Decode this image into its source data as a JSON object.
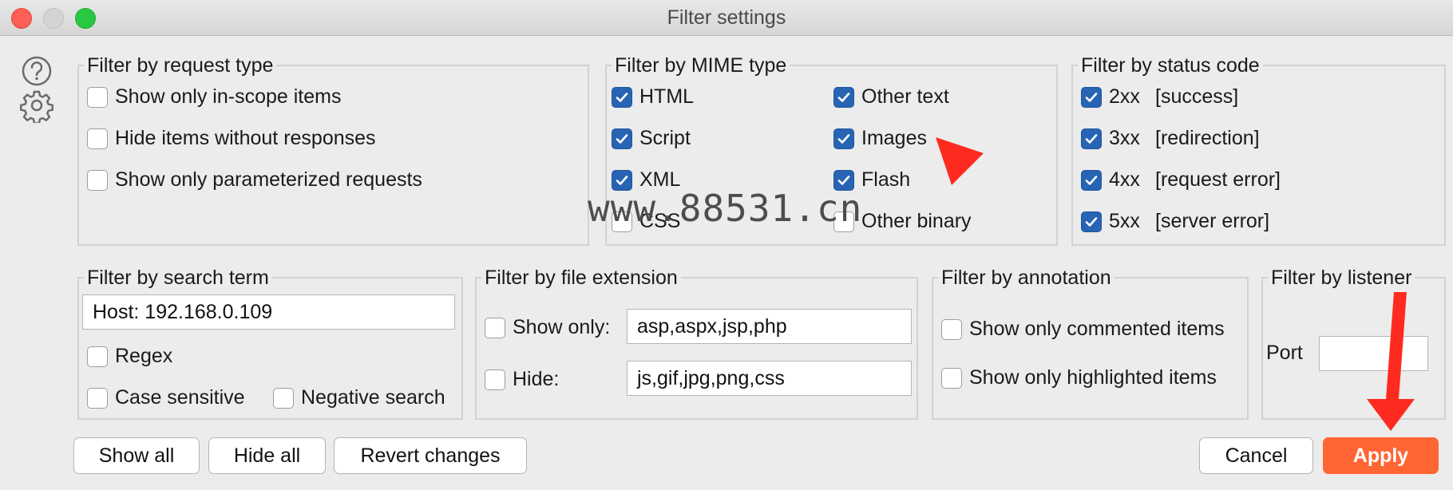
{
  "window": {
    "title": "Filter settings"
  },
  "sidebar": {
    "help_icon": "question-circle-icon",
    "settings_icon": "gear-icon"
  },
  "request_type": {
    "title": "Filter by request type",
    "items": [
      {
        "label": "Show only in-scope items",
        "checked": false
      },
      {
        "label": "Hide items without responses",
        "checked": false
      },
      {
        "label": "Show only parameterized requests",
        "checked": false
      }
    ]
  },
  "mime_type": {
    "title": "Filter by MIME type",
    "items": [
      {
        "label": "HTML",
        "checked": true
      },
      {
        "label": "Other text",
        "checked": true
      },
      {
        "label": "Script",
        "checked": true
      },
      {
        "label": "Images",
        "checked": true
      },
      {
        "label": "XML",
        "checked": true
      },
      {
        "label": "Flash",
        "checked": true
      },
      {
        "label": "CSS",
        "checked": false
      },
      {
        "label": "Other binary",
        "checked": false
      }
    ]
  },
  "status_code": {
    "title": "Filter by status code",
    "items": [
      {
        "code": "2xx",
        "desc": "[success]",
        "checked": true
      },
      {
        "code": "3xx",
        "desc": "[redirection]",
        "checked": true
      },
      {
        "code": "4xx",
        "desc": "[request error]",
        "checked": true
      },
      {
        "code": "5xx",
        "desc": "[server error]",
        "checked": true
      }
    ]
  },
  "search_term": {
    "title": "Filter by search term",
    "value": "Host: 192.168.0.109",
    "regex_label": "Regex",
    "regex_checked": false,
    "case_label": "Case sensitive",
    "case_checked": false,
    "negative_label": "Negative search",
    "negative_checked": false
  },
  "file_extension": {
    "title": "Filter by file extension",
    "show_only_label": "Show only:",
    "show_only_checked": false,
    "show_only_value": "asp,aspx,jsp,php",
    "hide_label": "Hide:",
    "hide_checked": false,
    "hide_value": "js,gif,jpg,png,css"
  },
  "annotation": {
    "title": "Filter by annotation",
    "commented_label": "Show only commented items",
    "commented_checked": false,
    "highlighted_label": "Show only highlighted items",
    "highlighted_checked": false
  },
  "listener": {
    "title": "Filter by listener",
    "port_label": "Port",
    "port_value": ""
  },
  "buttons": {
    "show_all": "Show all",
    "hide_all": "Hide all",
    "revert": "Revert changes",
    "cancel": "Cancel",
    "apply": "Apply"
  },
  "watermark": "www.88531.cn",
  "colors": {
    "accent_checkbox": "#2864b4",
    "apply_button": "#ff6633",
    "annotation_arrow": "#ff2a1f"
  }
}
